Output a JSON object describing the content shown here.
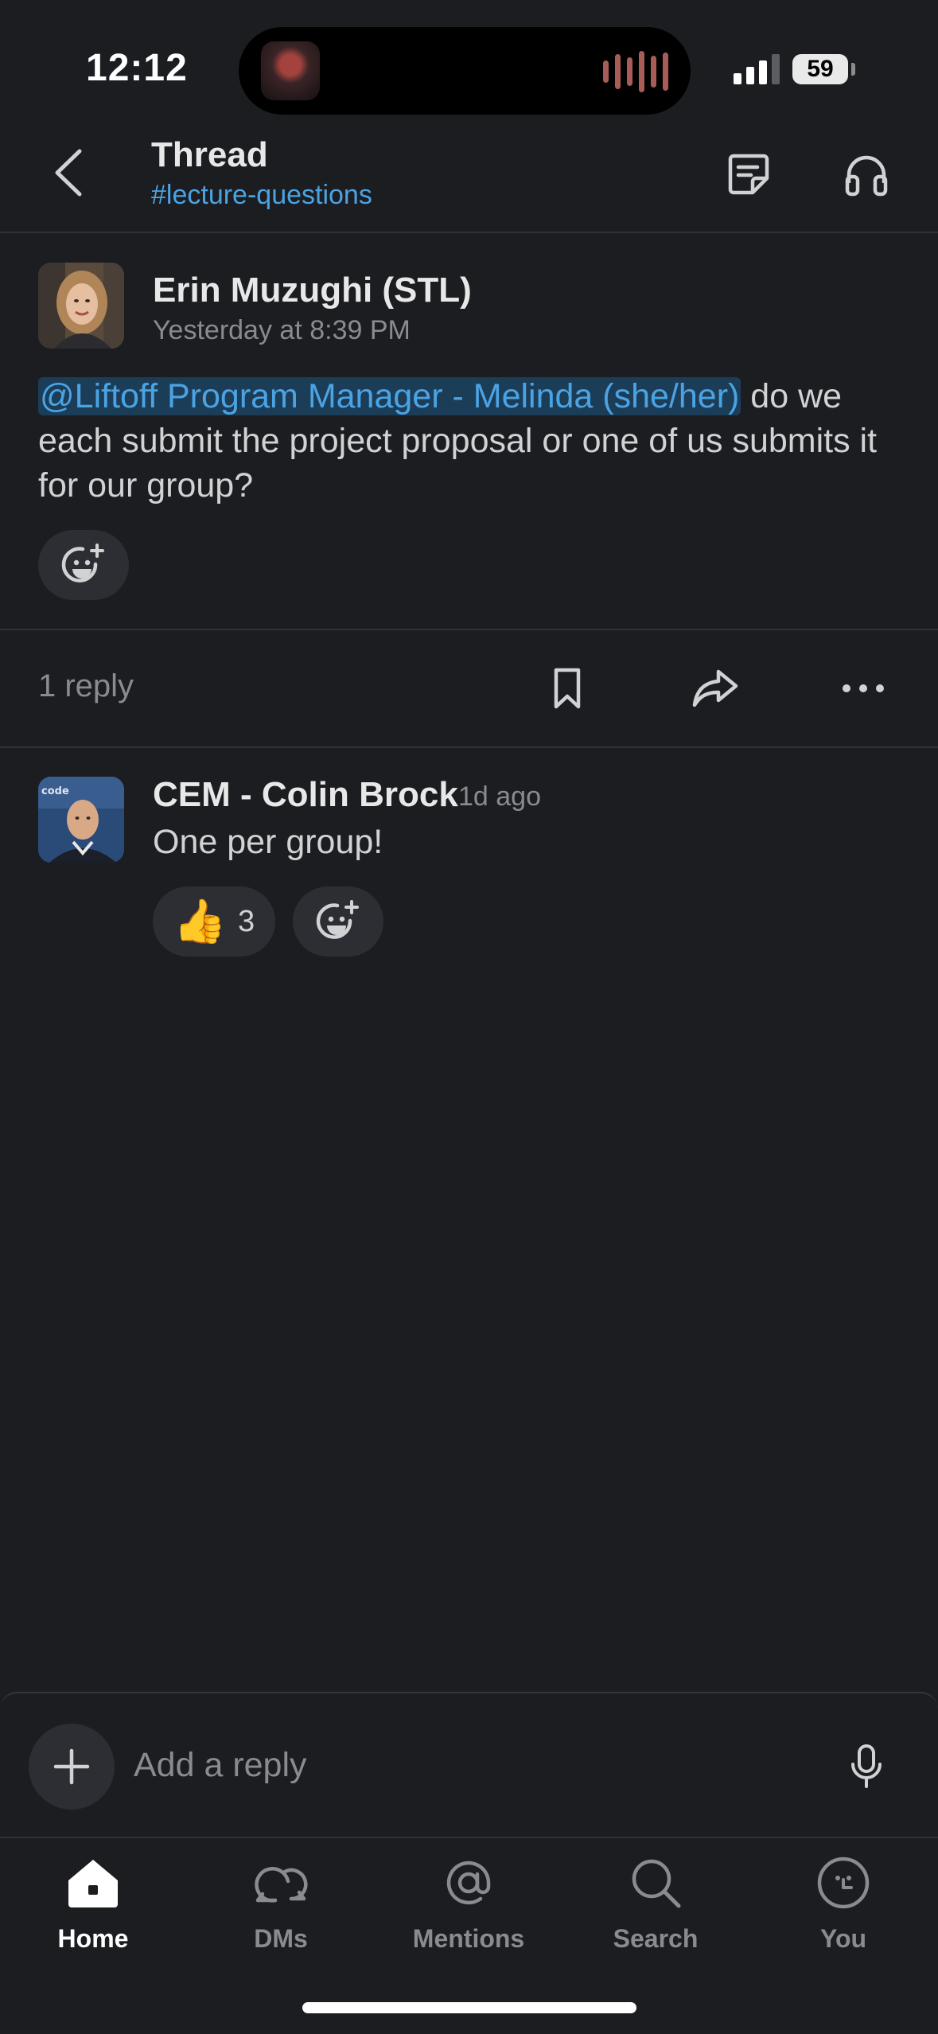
{
  "status_bar": {
    "time": "12:12",
    "battery": "59"
  },
  "header": {
    "title": "Thread",
    "channel": "#lecture-questions"
  },
  "parent_message": {
    "author": "Erin Muzughi (STL)",
    "timestamp": "Yesterday at 8:39 PM",
    "mention": "@Liftoff Program Manager - Melinda (she/her)",
    "text": " do we each submit the project proposal or one of us submits it for our group?"
  },
  "thread_actions": {
    "reply_count": "1 reply"
  },
  "replies": [
    {
      "author": "CEM - Colin Brock",
      "timestamp": "1d ago",
      "text": "One per group!",
      "reaction": {
        "emoji": "👍",
        "count": "3"
      }
    }
  ],
  "composer": {
    "placeholder": "Add a reply"
  },
  "tabs": [
    {
      "label": "Home",
      "icon": "home-icon",
      "active": true
    },
    {
      "label": "DMs",
      "icon": "dms-icon",
      "active": false
    },
    {
      "label": "Mentions",
      "icon": "at-icon",
      "active": false
    },
    {
      "label": "Search",
      "icon": "search-icon",
      "active": false
    },
    {
      "label": "You",
      "icon": "you-icon",
      "active": false
    }
  ],
  "colors": {
    "background": "#1b1d21",
    "link": "#4ba3e3",
    "mention_bg": "#1c3d58",
    "pill": "#2c2e33"
  }
}
